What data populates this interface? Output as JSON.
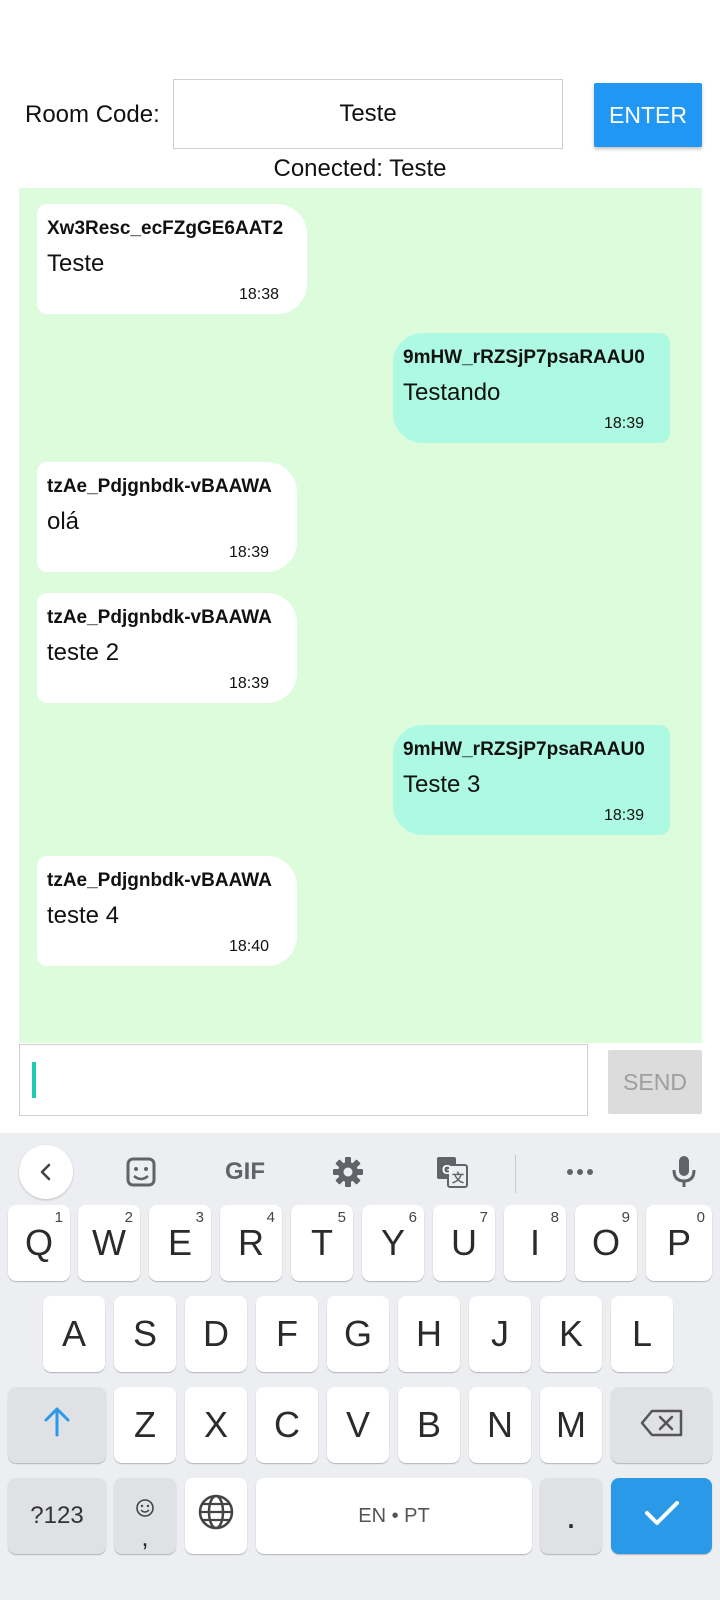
{
  "header": {
    "room_label": "Room Code:",
    "room_value": "Teste",
    "enter_label": "ENTER",
    "status": "Conected: Teste"
  },
  "messages": [
    {
      "user": "Xw3Resc_ecFZgGE6AAT2",
      "text": "Teste",
      "time": "18:38",
      "side": "left"
    },
    {
      "user": "9mHW_rRZSjP7psaRAAU0",
      "text": "Testando",
      "time": "18:39",
      "side": "right"
    },
    {
      "user": "tzAe_Pdjgnbdk-vBAAWA",
      "text": "olá",
      "time": "18:39",
      "side": "left"
    },
    {
      "user": "tzAe_Pdjgnbdk-vBAAWA",
      "text": "teste 2",
      "time": "18:39",
      "side": "left"
    },
    {
      "user": "9mHW_rRZSjP7psaRAAU0",
      "text": "Teste 3",
      "time": "18:39",
      "side": "right"
    },
    {
      "user": "tzAe_Pdjgnbdk-vBAAWA",
      "text": "teste 4",
      "time": "18:40",
      "side": "left"
    }
  ],
  "compose": {
    "input_value": "",
    "send_label": "SEND"
  },
  "keyboard": {
    "toolbar": {
      "gif_label": "GIF",
      "icons": [
        "back-chevron-icon",
        "sticker-icon",
        "gif-icon",
        "settings-gear-icon",
        "translate-icon",
        "more-icon",
        "microphone-icon"
      ]
    },
    "row1": [
      {
        "key": "Q",
        "hint": "1"
      },
      {
        "key": "W",
        "hint": "2"
      },
      {
        "key": "E",
        "hint": "3"
      },
      {
        "key": "R",
        "hint": "4"
      },
      {
        "key": "T",
        "hint": "5"
      },
      {
        "key": "Y",
        "hint": "6"
      },
      {
        "key": "U",
        "hint": "7"
      },
      {
        "key": "I",
        "hint": "8"
      },
      {
        "key": "O",
        "hint": "9"
      },
      {
        "key": "P",
        "hint": "0"
      }
    ],
    "row2": [
      "A",
      "S",
      "D",
      "F",
      "G",
      "H",
      "J",
      "K",
      "L"
    ],
    "row3": [
      "Z",
      "X",
      "C",
      "V",
      "B",
      "N",
      "M"
    ],
    "symbols_label": "?123",
    "emoji_comma_label": ",",
    "space_label": "EN • PT",
    "period_label": ".",
    "colors": {
      "accent": "#2196f3",
      "enter_key": "#2a99e8",
      "chat_bg": "#dcfcdc",
      "own_bubble": "#adf9e2"
    }
  }
}
